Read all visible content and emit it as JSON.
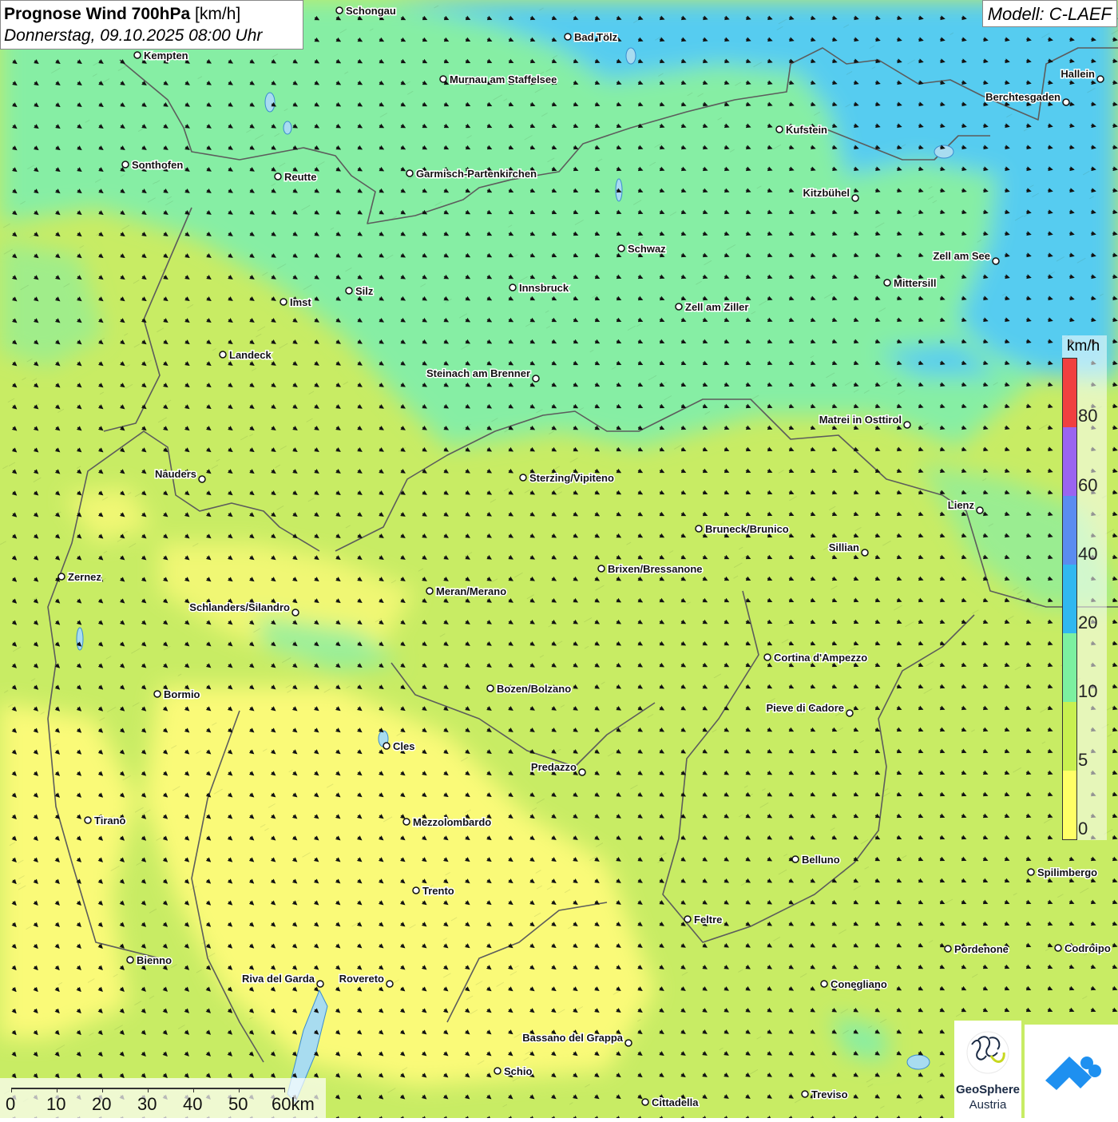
{
  "title": {
    "main": "Prognose Wind 700hPa",
    "unit": "[km/h]",
    "datetime": "Donnerstag, 09.10.2025 08:00 Uhr"
  },
  "model": "Modell: C-LAEF",
  "legend": {
    "unit": "km/h",
    "ticks": [
      "80",
      "60",
      "40",
      "20",
      "10",
      "5",
      "0"
    ],
    "colors": [
      "#ffff66",
      "#c8f050",
      "#7cf0a0",
      "#30b8f0",
      "#5a8cf0",
      "#9a64f0",
      "#f04040",
      "#c8e8f8"
    ]
  },
  "scale": {
    "labels": [
      "0",
      "10",
      "20",
      "30",
      "40",
      "50",
      "60km"
    ]
  },
  "logos": {
    "geosphere_line1": "GeoSphere",
    "geosphere_line2": "Austria"
  },
  "cities": [
    {
      "name": "Schongau"
    },
    {
      "name": "Bad Tölz"
    },
    {
      "name": "Kempten"
    },
    {
      "name": "Murnau am Staffelsee"
    },
    {
      "name": "Hallein"
    },
    {
      "name": "Berchtesgaden"
    },
    {
      "name": "Kufstein"
    },
    {
      "name": "Sonthofen"
    },
    {
      "name": "Reutte"
    },
    {
      "name": "Garmisch-Partenkirchen"
    },
    {
      "name": "Kitzbühel"
    },
    {
      "name": "Schwaz"
    },
    {
      "name": "Zell am See"
    },
    {
      "name": "Mittersill"
    },
    {
      "name": "Innsbruck"
    },
    {
      "name": "Silz"
    },
    {
      "name": "Imst"
    },
    {
      "name": "Zell am Ziller"
    },
    {
      "name": "Landeck"
    },
    {
      "name": "Steinach am Brenner"
    },
    {
      "name": "Matrei in Osttirol"
    },
    {
      "name": "Nauders"
    },
    {
      "name": "Sterzing/Vipiteno"
    },
    {
      "name": "Lienz"
    },
    {
      "name": "Bruneck/Brunico"
    },
    {
      "name": "Sillian"
    },
    {
      "name": "Zernez"
    },
    {
      "name": "Brixen/Bressanone"
    },
    {
      "name": "Meran/Merano"
    },
    {
      "name": "Schlanders/Silandro"
    },
    {
      "name": "Cortina d'Ampezzo"
    },
    {
      "name": "Bormio"
    },
    {
      "name": "Bozen/Bolzano"
    },
    {
      "name": "Pieve di Cadore"
    },
    {
      "name": "Cles"
    },
    {
      "name": "Predazzo"
    },
    {
      "name": "Tirano"
    },
    {
      "name": "Mezzolombardo"
    },
    {
      "name": "Belluno"
    },
    {
      "name": "Spilimbergo"
    },
    {
      "name": "Trento"
    },
    {
      "name": "Feltre"
    },
    {
      "name": "Bienno"
    },
    {
      "name": "Pordenone"
    },
    {
      "name": "Codroipo"
    },
    {
      "name": "Riva del Garda"
    },
    {
      "name": "Rovereto"
    },
    {
      "name": "Conegliano"
    },
    {
      "name": "Bassano del Grappa"
    },
    {
      "name": "Schio"
    },
    {
      "name": "Treviso"
    },
    {
      "name": "Cittadella"
    }
  ]
}
